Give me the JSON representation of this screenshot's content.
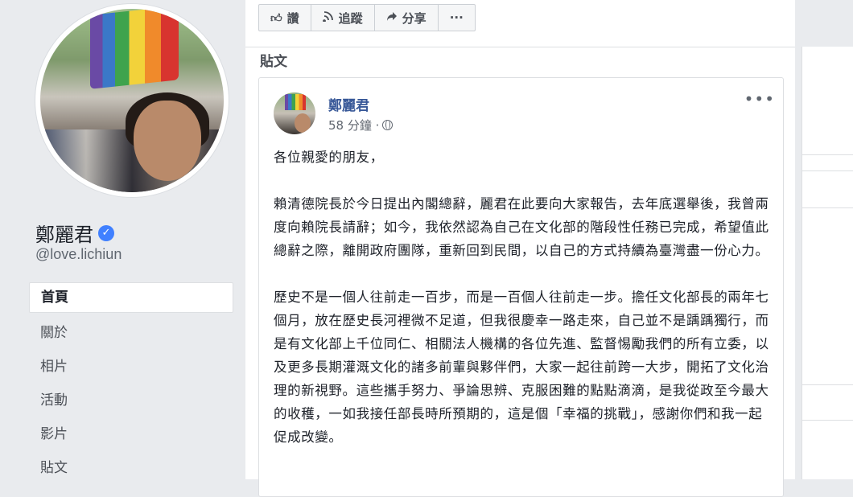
{
  "profile": {
    "name": "鄭麗君",
    "verified_mark": "✓",
    "handle": "@love.lichiun"
  },
  "nav": {
    "items": [
      {
        "label": "首頁"
      },
      {
        "label": "關於"
      },
      {
        "label": "相片"
      },
      {
        "label": "活動"
      },
      {
        "label": "影片"
      },
      {
        "label": "貼文"
      }
    ]
  },
  "actions": {
    "like": {
      "label": "讚",
      "icon": "thumbs-up-icon"
    },
    "follow": {
      "label": "追蹤",
      "icon": "wifi-follow-icon"
    },
    "share": {
      "label": "分享",
      "icon": "share-arrow-icon"
    },
    "more": {
      "label": "···",
      "icon": "more-dots-icon"
    }
  },
  "section": {
    "title": "貼文"
  },
  "post": {
    "author": "鄭麗君",
    "time": "58 分鐘 ·",
    "more": "•••",
    "paragraphs": [
      "各位親愛的朋友，",
      "賴清德院長於今日提出內閣總辭，麗君在此要向大家報告，去年底選舉後，我曾兩度向賴院長請辭；如今，我依然認為自己在文化部的階段性任務已完成，希望值此總辭之際，離開政府團隊，重新回到民間，以自己的方式持續為臺灣盡一份心力。",
      "歷史不是一個人往前走一百步，而是一百個人往前走一步。擔任文化部長的兩年七個月，放在歷史長河裡微不足道，但我很慶幸一路走來，自己並不是踽踽獨行，而是有文化部上千位同仁、相關法人機構的各位先進、監督惕勵我們的所有立委，以及更多長期灌溉文化的諸多前輩與夥伴們，大家一起往前跨一大步，開拓了文化治理的新視野。這些攜手努力、爭論思辨、克服困難的點點滴滴，是我從政至今最大的收穫，一如我接任部長時所預期的，這是個「幸福的挑戰」，感謝你們和我一起促成改變。"
    ]
  },
  "colors": {
    "page_bg": "#e9ebee",
    "link_blue": "#385898",
    "verified_blue": "#4080ff",
    "border": "#dddfe2"
  }
}
